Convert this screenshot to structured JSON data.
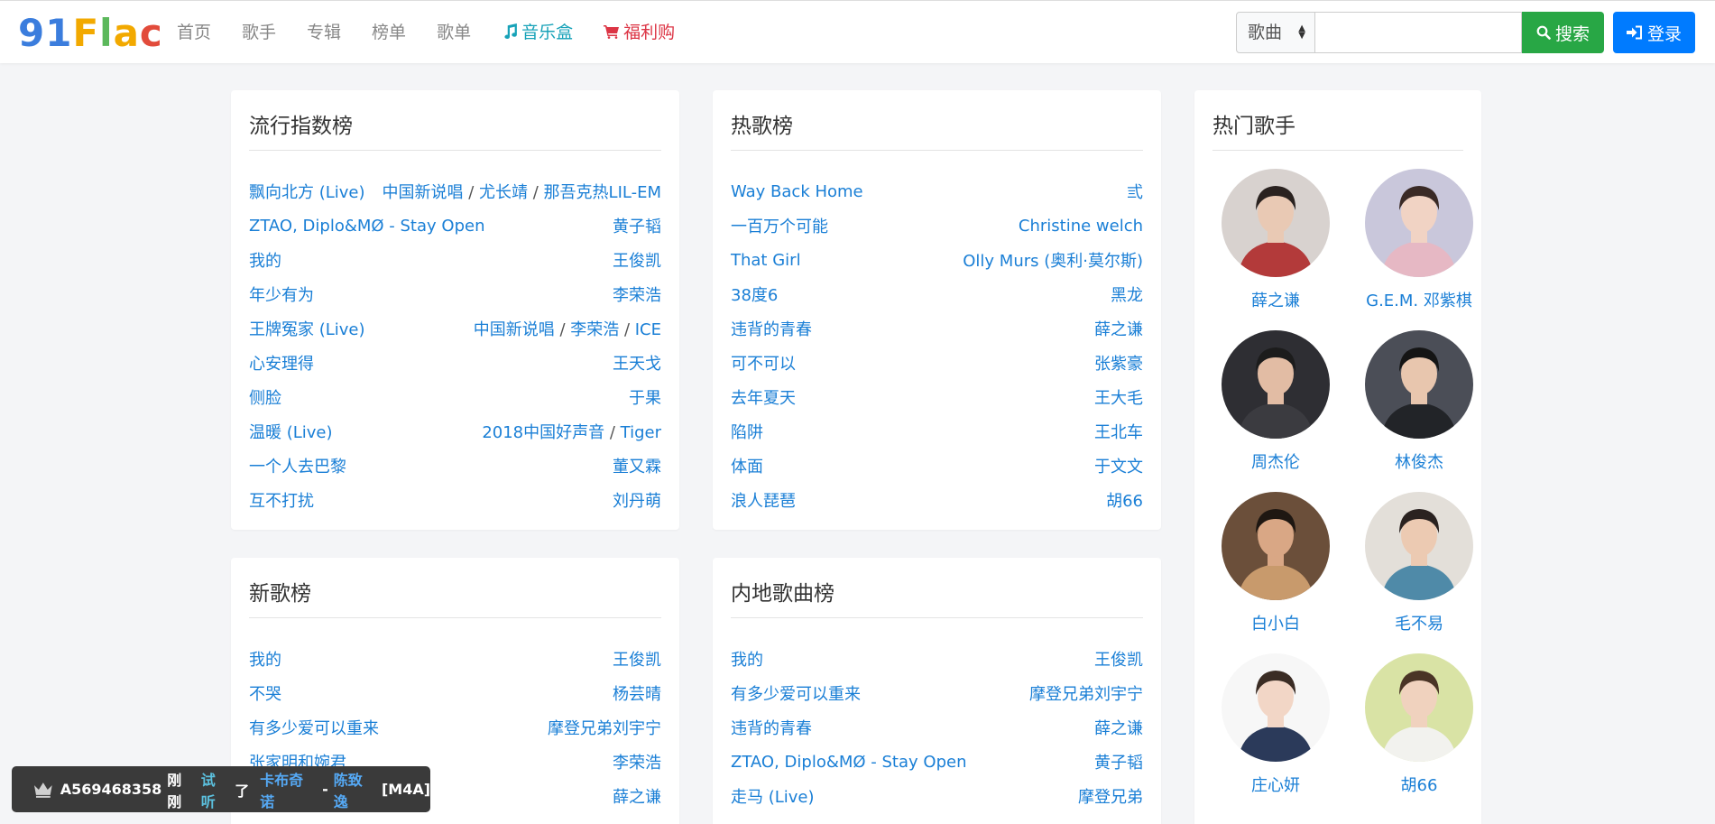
{
  "logo": {
    "text": [
      "9",
      "1",
      "F",
      "l",
      "a",
      "c"
    ],
    "colors": [
      "#3b7ddd",
      "#3b7ddd",
      "#f2a900",
      "#5cb85c",
      "#f2a900",
      "#e24b3b"
    ]
  },
  "nav": {
    "items": [
      {
        "label": "首页"
      },
      {
        "label": "歌手"
      },
      {
        "label": "专辑"
      },
      {
        "label": "榜单"
      },
      {
        "label": "歌单"
      }
    ],
    "musicbox": {
      "label": "音乐盒",
      "icon": "music-icon",
      "color": "#17a2b8"
    },
    "shop": {
      "label": "福利购",
      "icon": "cart-icon",
      "color": "#dc3545"
    }
  },
  "search": {
    "category": "歌曲",
    "input_value": "",
    "button_label": "搜索"
  },
  "login": {
    "label": "登录"
  },
  "popular_chart": {
    "title": "流行指数榜",
    "rows": [
      {
        "song": "飘向北方 (Live)",
        "artists": [
          "中国新说唱",
          "尤长靖",
          "那吾克热LIL-EM"
        ]
      },
      {
        "song": "ZTAO, Diplo&MØ - Stay Open",
        "artists": [
          "黄子韬"
        ]
      },
      {
        "song": "我的",
        "artists": [
          "王俊凯"
        ]
      },
      {
        "song": "年少有为",
        "artists": [
          "李荣浩"
        ]
      },
      {
        "song": "王牌冤家 (Live)",
        "artists": [
          "中国新说唱",
          "李荣浩",
          "ICE"
        ]
      },
      {
        "song": "心安理得",
        "artists": [
          "王天戈"
        ]
      },
      {
        "song": "侧脸",
        "artists": [
          "于果"
        ]
      },
      {
        "song": "温暖 (Live)",
        "artists": [
          "2018中国好声音",
          "Tiger"
        ]
      },
      {
        "song": "一个人去巴黎",
        "artists": [
          "董又霖"
        ]
      },
      {
        "song": "互不打扰",
        "artists": [
          "刘丹萌"
        ]
      }
    ]
  },
  "hot_chart": {
    "title": "热歌榜",
    "rows": [
      {
        "song": "Way Back Home",
        "artists": [
          "弎"
        ]
      },
      {
        "song": "一百万个可能",
        "artists": [
          "Christine welch"
        ]
      },
      {
        "song": "That Girl",
        "artists": [
          "Olly Murs (奥利·莫尔斯)"
        ]
      },
      {
        "song": "38度6",
        "artists": [
          "黑龙"
        ]
      },
      {
        "song": "违背的青春",
        "artists": [
          "薛之谦"
        ]
      },
      {
        "song": "可不可以",
        "artists": [
          "张紫豪"
        ]
      },
      {
        "song": "去年夏天",
        "artists": [
          "王大毛"
        ]
      },
      {
        "song": "陷阱",
        "artists": [
          "王北车"
        ]
      },
      {
        "song": "体面",
        "artists": [
          "于文文"
        ]
      },
      {
        "song": "浪人琵琶",
        "artists": [
          "胡66"
        ]
      }
    ]
  },
  "new_chart": {
    "title": "新歌榜",
    "rows": [
      {
        "song": "我的",
        "artists": [
          "王俊凯"
        ]
      },
      {
        "song": "不哭",
        "artists": [
          "杨芸晴"
        ]
      },
      {
        "song": "有多少爱可以重来",
        "artists": [
          "摩登兄弟刘宇宁"
        ]
      },
      {
        "song": "张家明和婉君",
        "artists": [
          "李荣浩"
        ]
      },
      {
        "song": "",
        "artists": [
          "薛之谦"
        ]
      }
    ]
  },
  "mainland_chart": {
    "title": "内地歌曲榜",
    "rows": [
      {
        "song": "我的",
        "artists": [
          "王俊凯"
        ]
      },
      {
        "song": "有多少爱可以重来",
        "artists": [
          "摩登兄弟刘宇宁"
        ]
      },
      {
        "song": "违背的青春",
        "artists": [
          "薛之谦"
        ]
      },
      {
        "song": "ZTAO, Diplo&MØ - Stay Open",
        "artists": [
          "黄子韬"
        ]
      },
      {
        "song": "走马 (Live)",
        "artists": [
          "摩登兄弟"
        ]
      }
    ]
  },
  "singers": {
    "title": "热门歌手",
    "items": [
      {
        "name": "薛之谦",
        "bg": "#d8d2cf",
        "skin": "#e9c9b4",
        "hair": "#2a2220",
        "shirt": "#b33a3a"
      },
      {
        "name": "G.E.M. 邓紫棋",
        "bg": "#c9c7db",
        "skin": "#f1d3c4",
        "hair": "#3a2a26",
        "shirt": "#e6b8c4"
      },
      {
        "name": "周杰伦",
        "bg": "#2e2e33",
        "skin": "#e2bca4",
        "hair": "#1c1c1c",
        "shirt": "#3b3b40"
      },
      {
        "name": "林俊杰",
        "bg": "#4b4e57",
        "skin": "#e8c6ae",
        "hair": "#151515",
        "shirt": "#222428"
      },
      {
        "name": "白小白",
        "bg": "#6b4f3a",
        "skin": "#d9a785",
        "hair": "#1e1712",
        "shirt": "#c89a6c"
      },
      {
        "name": "毛不易",
        "bg": "#e3dfd9",
        "skin": "#eccab2",
        "hair": "#2a2220",
        "shirt": "#4f8aa8"
      },
      {
        "name": "庄心妍",
        "bg": "#f7f7f7",
        "skin": "#f2d6c6",
        "hair": "#3a2c24",
        "shirt": "#2b3a5a"
      },
      {
        "name": "胡66",
        "bg": "#d9e3a5",
        "skin": "#f0d2be",
        "hair": "#4a3426",
        "shirt": "#f2f2ee"
      }
    ]
  },
  "toast": {
    "crown_icon": "crown-icon",
    "user": "A569468358",
    "time": "刚刚",
    "action": "试听",
    "particle": "了",
    "song": "卡布奇诺",
    "dash": "-",
    "artist": "陈致逸",
    "format": "[M4A]"
  }
}
